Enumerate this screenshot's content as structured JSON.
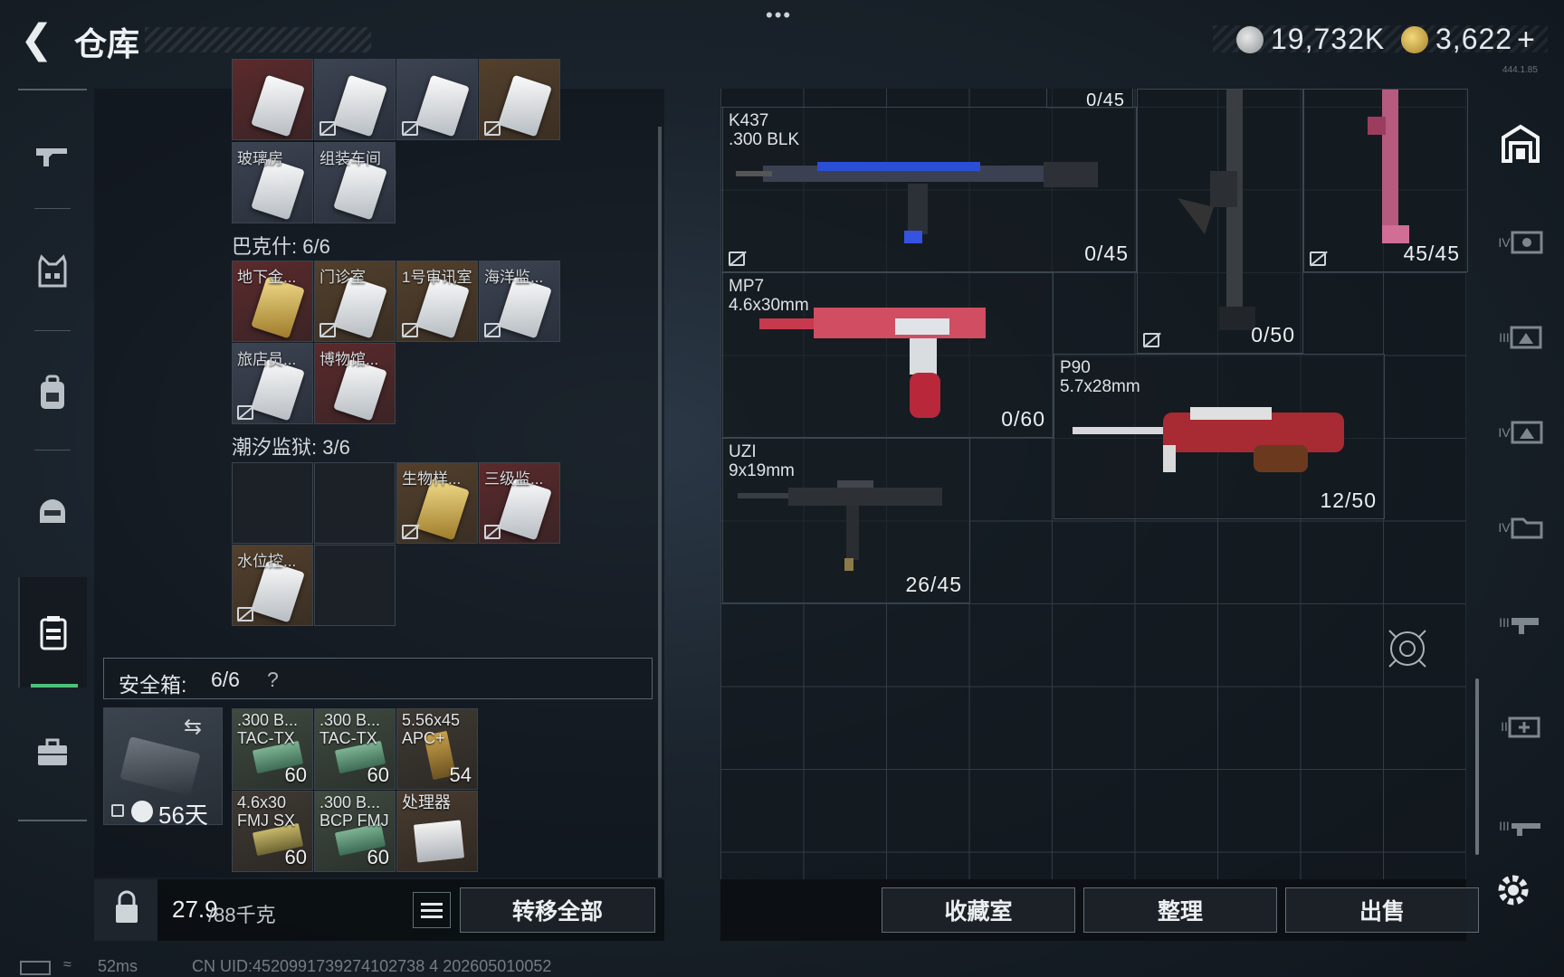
{
  "header": {
    "back_icon": "back-arrow-icon",
    "title": "仓库",
    "menu": "•••",
    "currency1": "19,732K",
    "currency2": "3,622",
    "plus": "+",
    "id_tiny": "444.1.85"
  },
  "left_nav": [
    {
      "icon": "rifle-icon"
    },
    {
      "icon": "armor-vest-icon"
    },
    {
      "icon": "backpack-icon"
    },
    {
      "icon": "helmet-icon"
    },
    {
      "icon": "container-icon",
      "active": true
    },
    {
      "icon": "briefcase-icon"
    }
  ],
  "keycards": {
    "top_row": [
      {
        "label": ""
      },
      {
        "label": ""
      },
      {
        "label": ""
      },
      {
        "label": ""
      }
    ],
    "group0": [
      {
        "label": "玻璃房"
      },
      {
        "label": "组装车间"
      }
    ],
    "group1_title": "巴克什: 6/6",
    "group1": [
      {
        "label": "地下金..."
      },
      {
        "label": "门诊室"
      },
      {
        "label": "1号审讯室"
      },
      {
        "label": "海洋监..."
      },
      {
        "label": "旅店员..."
      },
      {
        "label": "博物馆..."
      }
    ],
    "group2_title": "潮汐监狱: 3/6",
    "group2": [
      {
        "label": ""
      },
      {
        "label": ""
      },
      {
        "label": "生物样..."
      },
      {
        "label": "三级监..."
      },
      {
        "label": "水位控..."
      },
      {
        "label": ""
      }
    ]
  },
  "safebox": {
    "label": "安全箱:",
    "value": "6/6",
    "help": "?",
    "days": "56天",
    "items": [
      {
        "name": ".300 B...\nTAC-TX",
        "count": "60"
      },
      {
        "name": ".300 B...\nTAC-TX",
        "count": "60"
      },
      {
        "name": "5.56x45\nAPC+",
        "count": "54"
      },
      {
        "name": "4.6x30\nFMJ SX",
        "count": "60"
      },
      {
        "name": ".300 B...\nBCP FMJ",
        "count": "60"
      },
      {
        "name": "处理器",
        "count": ""
      }
    ]
  },
  "capacity": {
    "current": "27.9",
    "max": "/88千克"
  },
  "transfer_all": "转移全部",
  "status": {
    "ping": "52ms",
    "uid": "CN UID:4520991739274102738 4 202605010052"
  },
  "weapons": [
    {
      "name": "",
      "ammo": "0/45"
    },
    {
      "name": "K437\n.300 BLK",
      "ammo": "0/45"
    },
    {
      "name": "",
      "ammo": "0/50"
    },
    {
      "name": "",
      "ammo": "45/45"
    },
    {
      "name": "MP7\n4.6x30mm",
      "ammo": "0/60"
    },
    {
      "name": "P90\n5.7x28mm",
      "ammo": "12/50"
    },
    {
      "name": "UZI\n9x19mm",
      "ammo": "26/45"
    }
  ],
  "bottom_buttons": {
    "collection": "收藏室",
    "sort": "整理",
    "sell": "出售"
  },
  "right_nav": [
    {
      "icon": "warehouse-icon",
      "active": true
    },
    {
      "icon": "level4-gear-icon",
      "tier": "IV"
    },
    {
      "icon": "level3-armor-icon",
      "tier": "III"
    },
    {
      "icon": "level4-armor-icon",
      "tier": "IV"
    },
    {
      "icon": "level4-folder-icon",
      "tier": "IV"
    },
    {
      "icon": "level3-weapon-icon",
      "tier": "III"
    },
    {
      "icon": "level2-medkit-icon",
      "tier": "II"
    },
    {
      "icon": "level3-rifle-icon",
      "tier": "III"
    },
    {
      "icon": "settings-icon"
    }
  ]
}
